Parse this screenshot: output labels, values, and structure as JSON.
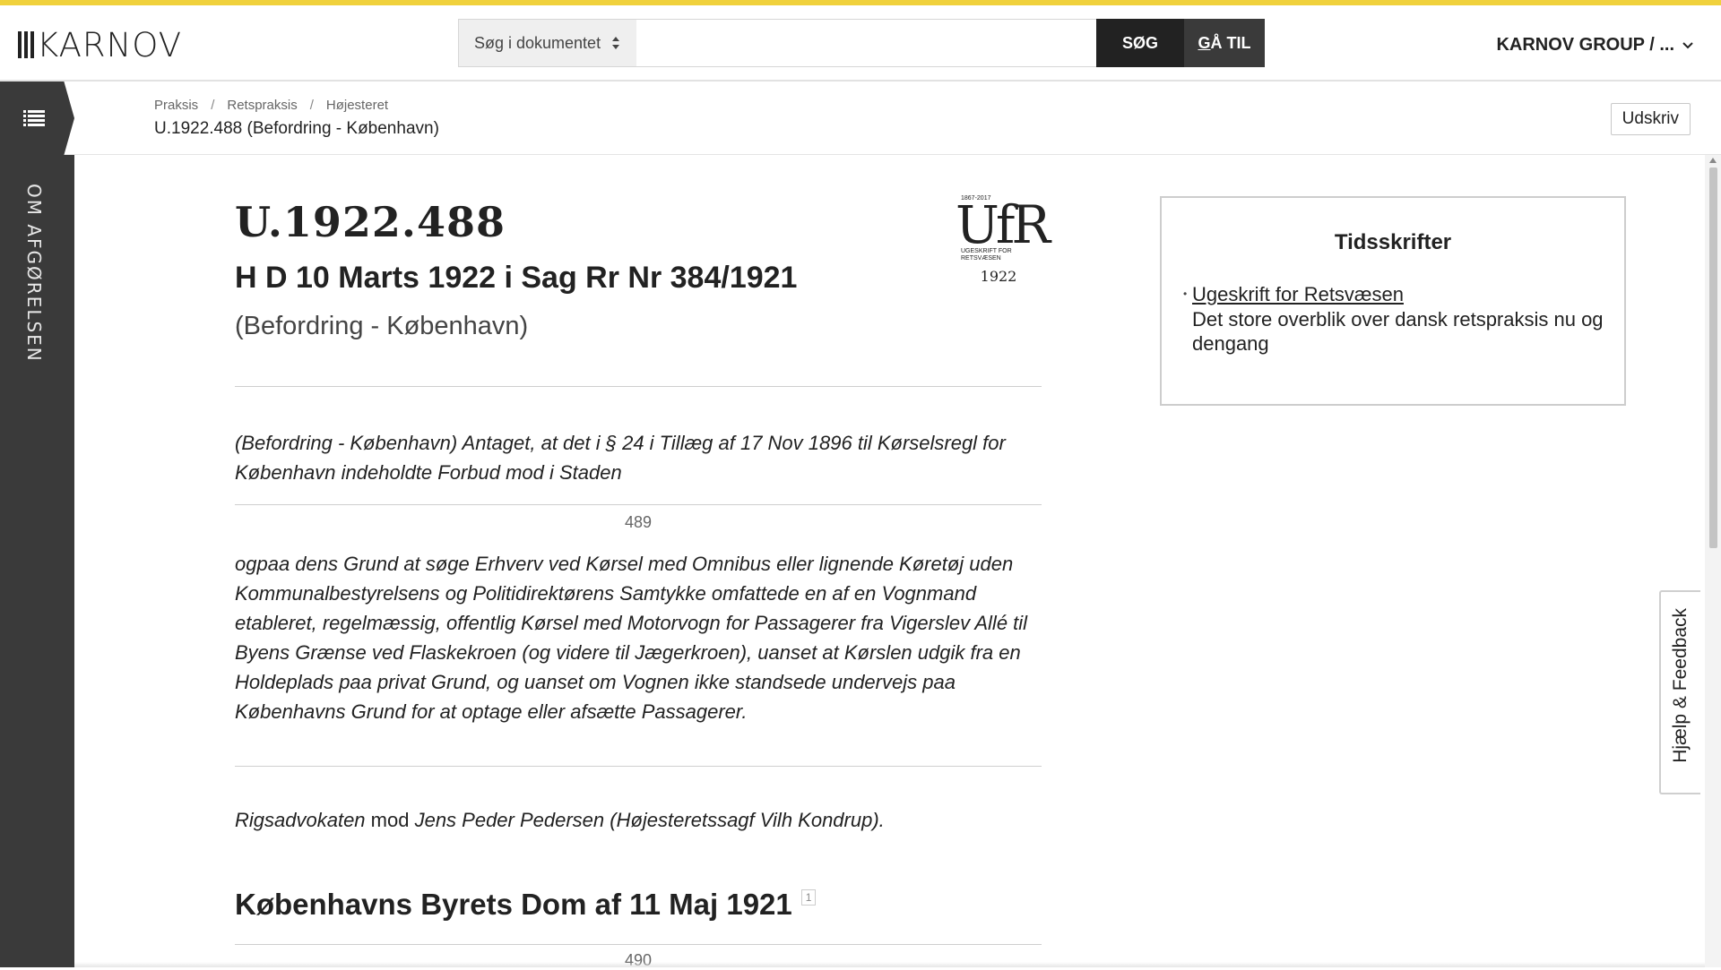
{
  "brand": {
    "logo_text": "KARNOV",
    "accent_color": "#f0d13c"
  },
  "header": {
    "search_scope": "Søg i dokumentet",
    "search_placeholder": "",
    "search_button": "SØG",
    "goto_button_underlined": "G",
    "goto_button_rest": "Å TIL",
    "account_label": "KARNOV GROUP / ..."
  },
  "breadcrumb": {
    "items": [
      "Praksis",
      "Retspraksis",
      "Højesteret"
    ],
    "separator": "/",
    "current": "U.1922.488 (Befordring - København)"
  },
  "toolbar": {
    "print_label": "Udskriv"
  },
  "sidebar": {
    "label": "OM AFGØRELSEN"
  },
  "document": {
    "id": "U.1922.488",
    "subtitle": "H D 10 Marts 1922 i Sag Rr Nr 384/1921",
    "category": "(Befordring - København)",
    "ufr": {
      "years": "1867-2017",
      "mark": "UfR",
      "caption_line1": "UGESKRIFT FOR",
      "caption_line2": "RETSVÆSEN",
      "year": "1922"
    },
    "summary_part1": "(Befordring - København) Antaget, at det i § 24 i Tillæg af 17 Nov 1896 til Kørselsregl for København indeholdte Forbud mod i Staden",
    "page_489": "489",
    "summary_part2": "ogpaa dens Grund at søge Erhverv ved Kørsel med Omnibus eller lignende Køretøj uden Kommunalbestyrelsens og Politidirektørens Samtykke omfattede en af en Vognmand etableret, regelmæssig, offentlig Kørsel med Motorvogn for Passagerer fra Vigerslev Allé til Byens Grænse ved Flaskekroen (og videre til Jægerkroen), uanset at Kørslen udgik fra en Holdeplads paa privat Grund, og uanset om Vognen ikke standsede undervejs paa Københavns Grund for at optage eller afsætte Passagerer.",
    "parties_plaintiff": "Rigsadvokaten",
    "parties_word": " mod ",
    "parties_defendant": "Jens Peder Pedersen (Højesteretssagf Vilh Kondrup).",
    "section_heading": "Københavns Byrets Dom af 11 Maj 1921",
    "footnote_ref": "1",
    "page_490": "490"
  },
  "aside": {
    "title": "Tidsskrifter",
    "bullet": "•",
    "link": "Ugeskrift for Retsvæsen",
    "description": "Det store overblik over dansk retspraksis nu og dengang"
  },
  "feedback": {
    "label": "Hjælp & Feedback"
  }
}
